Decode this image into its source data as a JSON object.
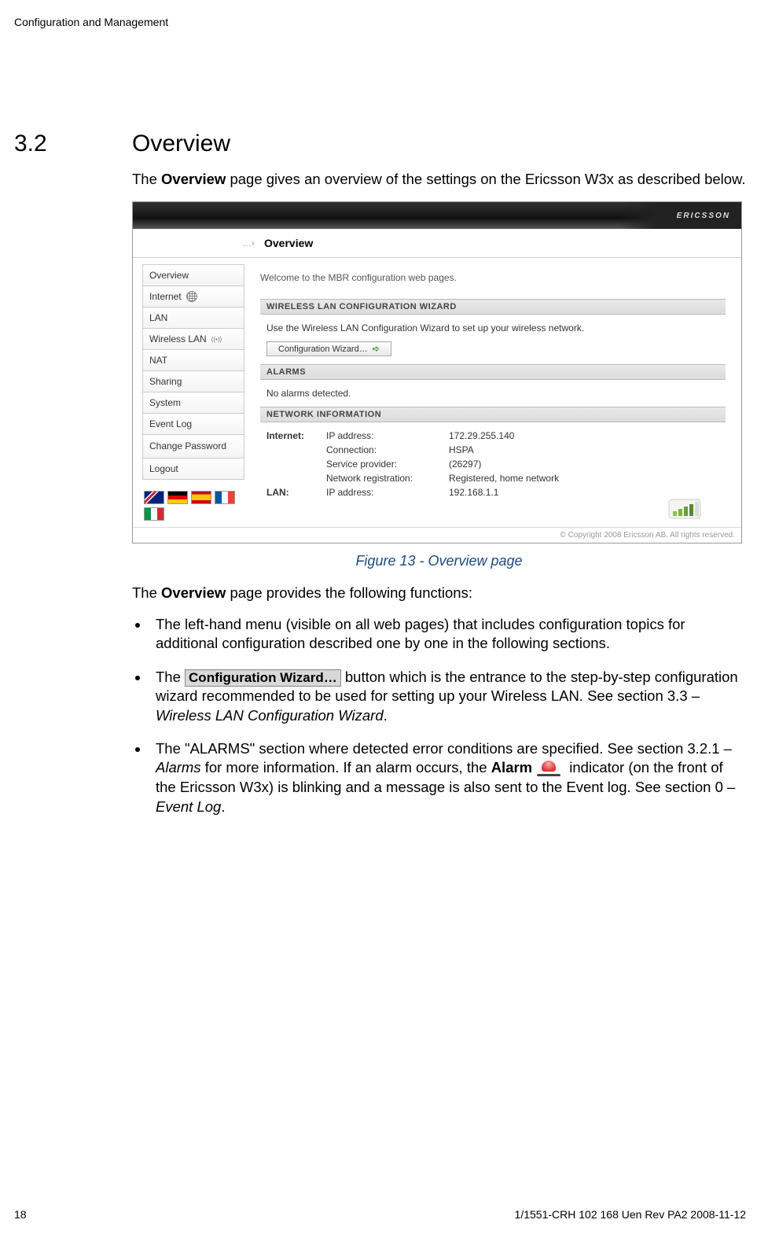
{
  "doc": {
    "header": "Configuration and Management",
    "section_number": "3.2",
    "section_title": "Overview",
    "intro_prefix": "The ",
    "intro_bold": "Overview",
    "intro_suffix": " page gives an overview of the settings on the Ericsson W3x as described below.",
    "caption": "Figure 13 - Overview page",
    "functions_prefix": "The ",
    "functions_bold": "Overview",
    "functions_suffix": " page provides the following functions:",
    "bullets": {
      "b1": "The left-hand menu (visible on all web pages) that includes configuration topics for additional configuration described one by one in the following sections.",
      "b2_a": "The  ",
      "b2_btn": "Configuration Wizard…",
      "b2_b": "  button which is the entrance to the step-by-step configuration wizard recommended to be used for setting up your Wireless LAN. See section 3.3 – ",
      "b2_i": "Wireless LAN Configuration Wizard",
      "b2_c": ".",
      "b3_a": "The \"ALARMS\" section where detected error conditions are specified. See section 3.2.1 – ",
      "b3_i1": "Alarms",
      "b3_b": " for more information. If an alarm occurs, the ",
      "b3_bold": "Alarm",
      "b3_c": " indicator (on the front of the Ericsson W3x) is blinking and a message is also sent to the Event log. See section 0 – ",
      "b3_i2": "Event Log",
      "b3_d": "."
    },
    "footer_page": "18",
    "footer_ref": "1/1551-CRH 102 168 Uen Rev PA2  2008-11-12"
  },
  "screenshot": {
    "logo": "ERICSSON",
    "breadcrumb_arrow": "…›",
    "breadcrumb_title": "Overview",
    "nav": [
      "Overview",
      "Internet",
      "LAN",
      "Wireless LAN",
      "NAT",
      "Sharing",
      "System",
      "Event Log",
      "Change Password",
      "Logout"
    ],
    "welcome": "Welcome to the MBR configuration web pages.",
    "panel_wlan_title": "WIRELESS LAN CONFIGURATION WIZARD",
    "panel_wlan_text": "Use the Wireless LAN Configuration Wizard to set up your wireless network.",
    "panel_wlan_button": "Configuration Wizard…",
    "panel_alarms_title": "ALARMS",
    "panel_alarms_text": "No alarms detected.",
    "panel_net_title": "NETWORK INFORMATION",
    "net_rows": {
      "r1_cat": "Internet:",
      "r1_k": "IP address:",
      "r1_v": "172.29.255.140",
      "r2_k": "Connection:",
      "r2_v": "HSPA",
      "r3_k": "Service provider:",
      "r3_v": "(26297)",
      "r4_k": "Network registration:",
      "r4_v": "Registered, home network",
      "r5_cat": "LAN:",
      "r5_k": "IP address:",
      "r5_v": "192.168.1.1"
    },
    "copyright": "© Copyright 2008 Ericsson AB. All rights reserved."
  }
}
